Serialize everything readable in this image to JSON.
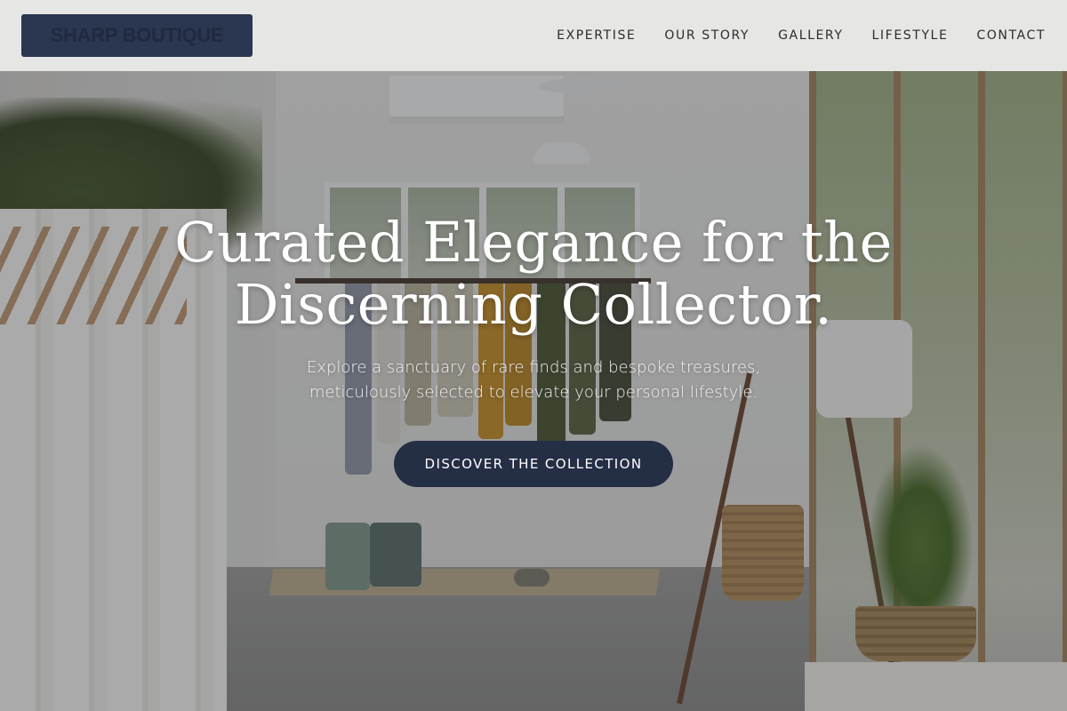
{
  "brand": {
    "logo_text": "SHARP BOUTIQUE"
  },
  "nav": {
    "items": [
      {
        "label": "EXPERTISE"
      },
      {
        "label": "OUR STORY"
      },
      {
        "label": "GALLERY"
      },
      {
        "label": "LIFESTYLE"
      },
      {
        "label": "CONTACT"
      }
    ]
  },
  "hero": {
    "title_line1": "Curated Elegance for the",
    "title_line2": "Discerning Collector.",
    "subtitle_line1": "Explore a sanctuary of rare finds and bespoke treasures,",
    "subtitle_line2": "meticulously selected to elevate your personal lifestyle.",
    "cta_label": "DISCOVER THE COLLECTION"
  },
  "colors": {
    "accent": "#242e45",
    "header_bg": "#ecebeb",
    "logo_bg": "#2b3650"
  }
}
